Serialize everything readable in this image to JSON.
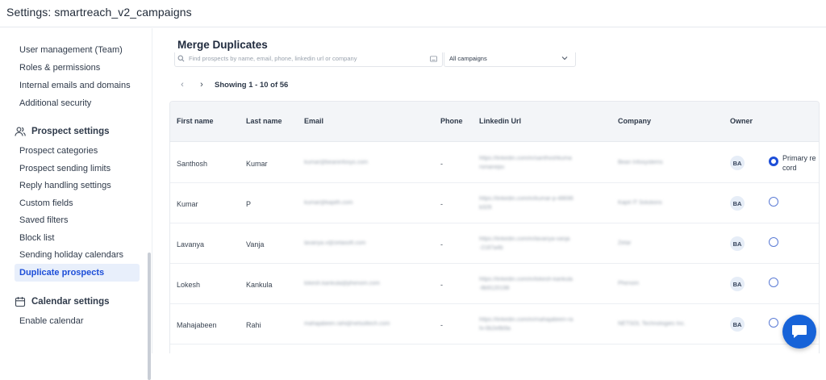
{
  "header": {
    "title": "Settings: smartreach_v2_campaigns"
  },
  "sidebar": {
    "account_items": [
      "User management (Team)",
      "Roles & permissions",
      "Internal emails and domains",
      "Additional security"
    ],
    "prospect_section": "Prospect settings",
    "prospect_items": [
      "Prospect categories",
      "Prospect sending limits",
      "Reply handling settings",
      "Custom fields",
      "Saved filters",
      "Block list",
      "Sending holiday calendars"
    ],
    "active_item": "Duplicate prospects",
    "calendar_section": "Calendar settings",
    "calendar_items": [
      "Enable calendar"
    ]
  },
  "main": {
    "title": "Merge Duplicates",
    "search_placeholder": "Find prospects by name, email, phone, linkedin url or company",
    "campaign_filter": "All campaigns",
    "showing": "Showing 1 - 10 of 56",
    "columns": [
      "First name",
      "Last name",
      "Email",
      "Phone",
      "Linkedin Url",
      "Company",
      "Owner"
    ],
    "primary_label": "Primary record",
    "rows": [
      {
        "first": "Santhosh",
        "last": "Kumar",
        "email": "kumar@beaninfosys.com",
        "phone": "-",
        "linkedin_1": "https://linkedin.com/in/santhoshkuma",
        "linkedin_2": "rsmanepu",
        "company": "Bean Infosystems",
        "owner": "BA",
        "primary": true
      },
      {
        "first": "Kumar",
        "last": "P",
        "email": "kumar@kapith.com",
        "phone": "-",
        "linkedin_1": "https://linkedin.com/in/kumar-p-48696",
        "linkedin_2": "b326",
        "company": "Kapit IT Solutions",
        "owner": "BA",
        "primary": false
      },
      {
        "first": "Lavanya",
        "last": "Vanja",
        "email": "lavanya.v@zetasoft.com",
        "phone": "-",
        "linkedin_1": "https://linkedin.com/in/lavanya-vanja",
        "linkedin_2": "-2187a4b",
        "company": "Zetar",
        "owner": "BA",
        "primary": false
      },
      {
        "first": "Lokesh",
        "last": "Kankula",
        "email": "lokesh.kankula@phenom.com",
        "phone": "-",
        "linkedin_1": "https://linkedin.com/in/lokesh-kankula",
        "linkedin_2": "-8b9120198",
        "company": "Phenom",
        "owner": "BA",
        "primary": false
      },
      {
        "first": "Mahajabeen",
        "last": "Rahi",
        "email": "mahajabeen.rahi@netsoltech.com",
        "phone": "-",
        "linkedin_1": "https://linkedin.com/in/mahajabeen-ra",
        "linkedin_2": "hi-0b2e8b9a",
        "company": "NETSOL Technologies Inc.",
        "owner": "BA",
        "primary": false
      }
    ]
  },
  "colors": {
    "accent": "#1d4ed8",
    "chat": "#1763d8",
    "active_bg": "#e8effb"
  }
}
